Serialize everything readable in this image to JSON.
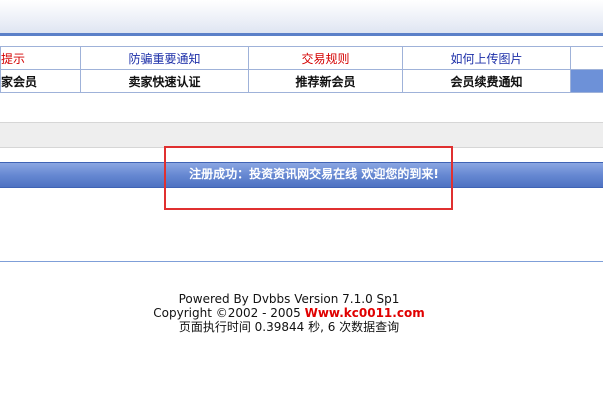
{
  "nav": {
    "row1": [
      "险提示",
      "防骗重要通知",
      "交易规则",
      "如何上传图片"
    ],
    "row2": [
      "卖家会员",
      "卖家快速认证",
      "推荐新会员",
      "会员续费通知"
    ]
  },
  "message": {
    "text": "注册成功：投资资讯网交易在线 欢迎您的到来!"
  },
  "footer": {
    "powered_by": "Powered By Dvbbs Version 7.1.0 Sp1",
    "copyright_prefix": "Copyright ©2002 - 2005 ",
    "brand_link": "Www.kc0011.com",
    "exec_time": "页面执行时间 0.39844 秒, 6 次数据查询"
  },
  "colors": {
    "accent_blue": "#5b80c8",
    "link_blue": "#1d2fa8",
    "warning_red": "#d40000",
    "highlight_box": "#e03030"
  }
}
